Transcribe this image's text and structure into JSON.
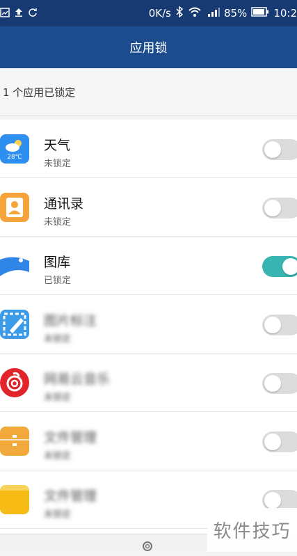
{
  "status_bar": {
    "network_speed": "0K/s",
    "battery_percent": "85%",
    "time": "10:2",
    "icons": [
      "image-icon",
      "upload-icon",
      "sync-icon",
      "bluetooth-icon",
      "wifi-icon",
      "signal-icon",
      "battery-icon"
    ]
  },
  "header": {
    "title": "应用锁"
  },
  "summary": {
    "text": "1 个应用已锁定"
  },
  "apps": [
    {
      "name": "天气",
      "status": "未锁定",
      "locked": false,
      "icon": "weather-icon",
      "icon_text": "28℃",
      "color": "#2f8ff0",
      "blurred": false
    },
    {
      "name": "通讯录",
      "status": "未锁定",
      "locked": false,
      "icon": "contacts-icon",
      "color": "#f6a33b",
      "blurred": false
    },
    {
      "name": "图库",
      "status": "已锁定",
      "locked": true,
      "icon": "gallery-icon",
      "color": "#2f86e6",
      "blurred": false
    },
    {
      "name": "图片标注",
      "status": "未锁定",
      "locked": false,
      "icon": "image-annotate-icon",
      "color": "#3b9be8",
      "blurred": true
    },
    {
      "name": "网易云音乐",
      "status": "未锁定",
      "locked": false,
      "icon": "netease-music-icon",
      "color": "#e0262b",
      "blurred": true
    },
    {
      "name": "文件管理",
      "status": "未锁定",
      "locked": false,
      "icon": "file-manager-icon",
      "color": "#f2a93b",
      "blurred": true
    },
    {
      "name": "文件管理",
      "status": "未锁定",
      "locked": false,
      "icon": "folder-icon",
      "color": "#f6bc15",
      "blurred": true
    }
  ],
  "bottom": {
    "icon": "gear-icon"
  },
  "watermark": {
    "text": "软件技巧"
  },
  "colors": {
    "header": "#1c4c8e",
    "statusbar": "#183a72",
    "toggle_on": "#38b5b0",
    "toggle_off": "#dcdcdc"
  }
}
